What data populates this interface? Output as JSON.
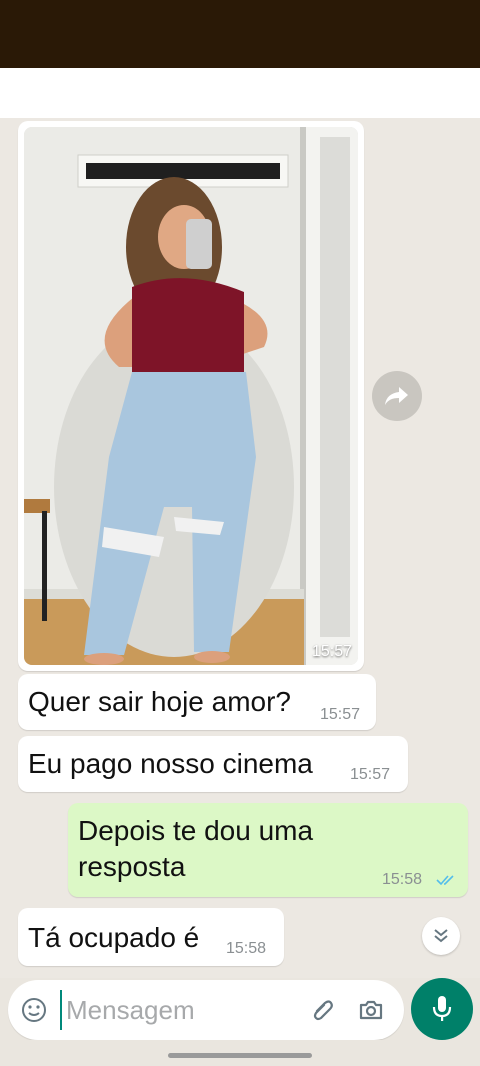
{
  "messages": [
    {
      "direction": "in",
      "type": "image",
      "time": "15:57"
    },
    {
      "direction": "in",
      "type": "text",
      "text": "Quer sair hoje amor?",
      "time": "15:57"
    },
    {
      "direction": "in",
      "type": "text",
      "text": "Eu pago nosso cinema",
      "time": "15:57"
    },
    {
      "direction": "out",
      "type": "text",
      "text_line1": "Depois te dou uma",
      "text_line2": "resposta",
      "time": "15:58",
      "status": "read"
    },
    {
      "direction": "in",
      "type": "text",
      "text": "Tá ocupado é",
      "time": "15:58"
    }
  ],
  "composer": {
    "placeholder": "Mensagem"
  },
  "icons": {
    "forward": "forward-icon",
    "scroll": "chevrons-down-icon",
    "emoji": "emoji-icon",
    "attach": "paperclip-icon",
    "camera": "camera-icon",
    "mic": "microphone-icon",
    "read_receipt": "double-check-icon"
  },
  "colors": {
    "status_bar": "#2a1906",
    "chat_bg": "#ece8e2",
    "outgoing_bubble": "#dcf8c6",
    "incoming_bubble": "#ffffff",
    "accent": "#008069",
    "read_tick": "#53bdeb"
  }
}
